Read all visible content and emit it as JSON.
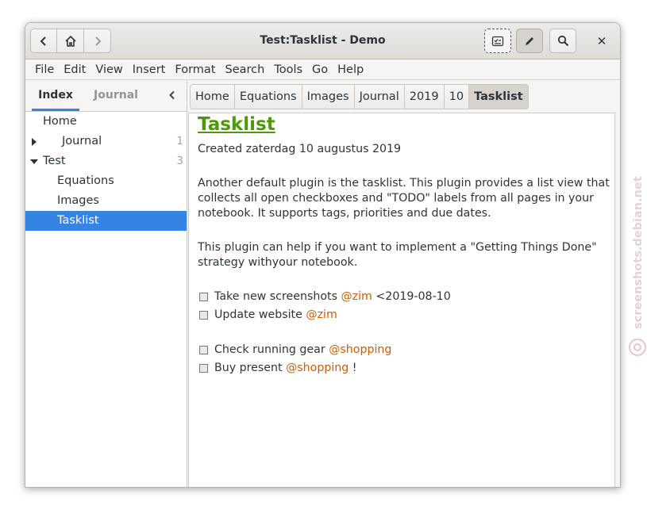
{
  "window": {
    "title": "Test:Tasklist - Demo",
    "close_glyph": "✕"
  },
  "menubar": [
    "File",
    "Edit",
    "View",
    "Insert",
    "Format",
    "Search",
    "Tools",
    "Go",
    "Help"
  ],
  "sidebar": {
    "tabs": {
      "index": "Index",
      "journal": "Journal"
    },
    "tree": [
      {
        "label": "Home",
        "count": "",
        "level": 0,
        "expander": "none"
      },
      {
        "label": "Journal",
        "count": "1",
        "level": 0,
        "expander": "collapsed"
      },
      {
        "label": "Test",
        "count": "3",
        "level": 0,
        "expander": "expanded"
      },
      {
        "label": "Equations",
        "count": "",
        "level": 1,
        "expander": "none"
      },
      {
        "label": "Images",
        "count": "",
        "level": 1,
        "expander": "none"
      },
      {
        "label": "Tasklist",
        "count": "",
        "level": 1,
        "expander": "none",
        "selected": true
      }
    ]
  },
  "pathbar": [
    "Home",
    "Equations",
    "Images",
    "Journal",
    "2019",
    "10",
    "Tasklist"
  ],
  "page": {
    "title": "Tasklist",
    "created": "Created zaterdag 10 augustus 2019",
    "paragraph1": "Another default plugin is the tasklist. This plugin provides a list view that collects all open checkboxes and \"TODO\" labels from all pages in your notebook. It supports tags, priorities and due dates.",
    "paragraph2": "This plugin can help if you want to implement a \"Getting Things Done\" strategy withyour notebook.",
    "tasks": [
      {
        "text": "Take new screenshots ",
        "tag": "@zim",
        "suffix": " <2019-08-10"
      },
      {
        "text": "Update website ",
        "tag": "@zim",
        "suffix": ""
      },
      {
        "text": "Check running gear ",
        "tag": "@shopping",
        "suffix": ""
      },
      {
        "text": "Buy present ",
        "tag": "@shopping",
        "suffix": " !"
      }
    ]
  },
  "watermark": "screenshots.debian.net",
  "colors": {
    "accent": "#3584e4",
    "title_green": "#4e9a06",
    "tag_orange": "#ce5c00"
  },
  "icons": [
    "back-icon",
    "home-icon",
    "forward-icon",
    "tasklist-icon",
    "pencil-icon",
    "search-icon",
    "close-icon",
    "chevron-left-icon",
    "expander-right-icon",
    "expander-down-icon",
    "debian-swirl-icon"
  ]
}
